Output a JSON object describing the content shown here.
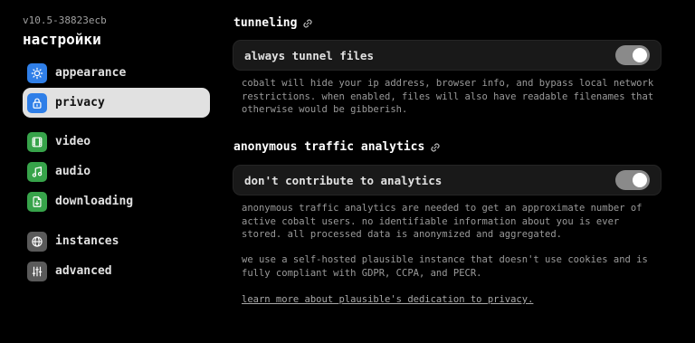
{
  "sidebar": {
    "version": "v10.5-38823ecb",
    "title": "настройки",
    "items": [
      {
        "label": "appearance",
        "icon": "sun-icon",
        "color": "#2f7fe8"
      },
      {
        "label": "privacy",
        "icon": "lock-icon",
        "color": "#2f7fe8",
        "active": true
      },
      {
        "label": "video",
        "icon": "film-icon",
        "color": "#37a34a"
      },
      {
        "label": "audio",
        "icon": "music-note-icon",
        "color": "#37a34a"
      },
      {
        "label": "downloading",
        "icon": "file-download-icon",
        "color": "#37a34a"
      },
      {
        "label": "instances",
        "icon": "globe-icon",
        "color": "#5a5a5a"
      },
      {
        "label": "advanced",
        "icon": "sliders-icon",
        "color": "#5a5a5a"
      }
    ]
  },
  "main": {
    "tunneling": {
      "title": "tunneling",
      "toggle_label": "always tunnel files",
      "toggle_on": true,
      "description": [
        "cobalt will hide your ip address, browser info, and bypass local network",
        "restrictions. when enabled, files will also have readable filenames that",
        "otherwise would be gibberish."
      ]
    },
    "analytics": {
      "title": "anonymous traffic analytics",
      "toggle_label": "don't contribute to analytics",
      "toggle_on": true,
      "description": [
        "anonymous traffic analytics are needed to get an approximate number of",
        "active cobalt users. no identifiable information about you is ever",
        "stored. all processed data is anonymized and aggregated."
      ],
      "description2": [
        "we use a self-hosted plausible instance that doesn't use cookies and is",
        "fully compliant with GDPR, CCPA, and PECR."
      ],
      "learn_more": "learn more about plausible's dedication to privacy."
    }
  }
}
